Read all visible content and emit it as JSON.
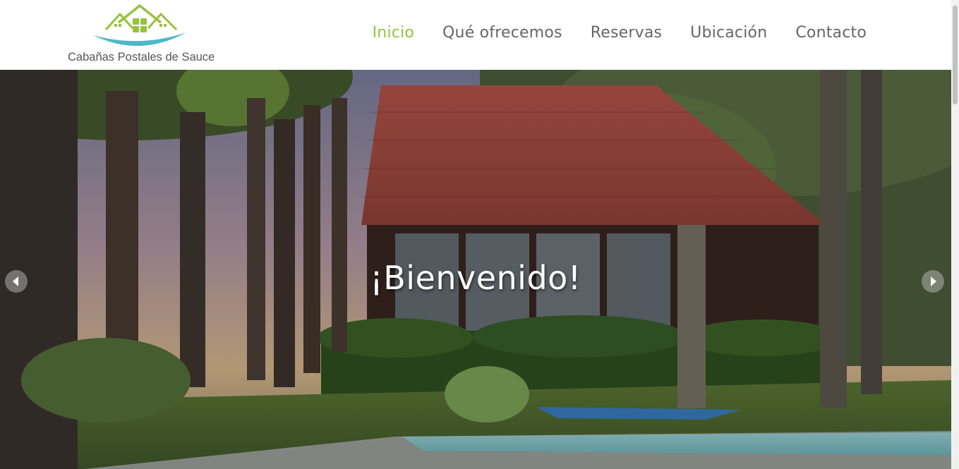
{
  "brand": {
    "name": "Cabañas Postales de Sauce",
    "logo_icon": "houses-logo-icon",
    "colors": {
      "green": "#97c23b",
      "teal": "#4db8c8"
    }
  },
  "nav": {
    "items": [
      {
        "label": "Inicio",
        "active": true
      },
      {
        "label": "Qué ofrecemos",
        "active": false
      },
      {
        "label": "Reservas",
        "active": false
      },
      {
        "label": "Ubicación",
        "active": false
      },
      {
        "label": "Contacto",
        "active": false
      }
    ],
    "active_color": "#97c23b",
    "color": "#666666"
  },
  "hero": {
    "title": "¡Bienvenido!",
    "prev_icon": "chevron-left-icon",
    "next_icon": "chevron-right-icon"
  }
}
